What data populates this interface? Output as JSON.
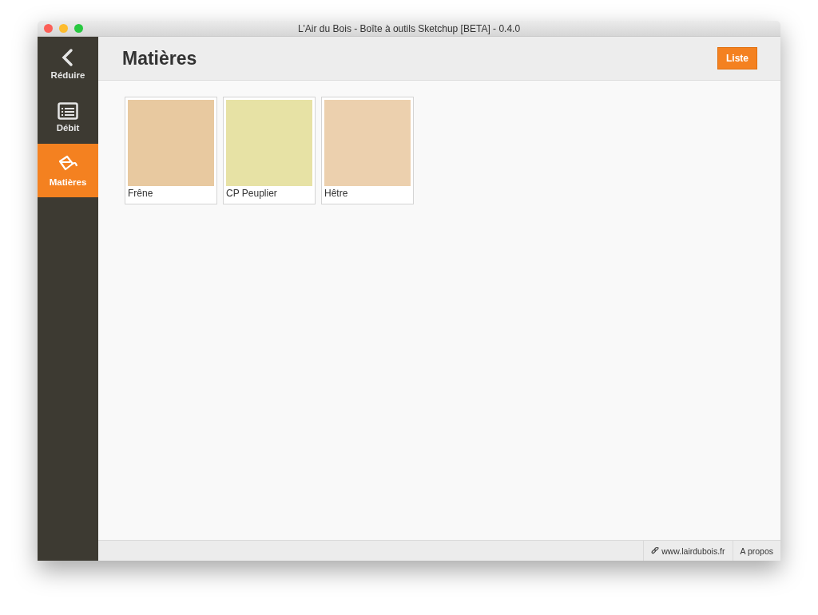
{
  "window": {
    "title": "L'Air du Bois - Boîte à outils Sketchup [BETA] - 0.4.0"
  },
  "sidebar": {
    "items": [
      {
        "kind": "back",
        "label": "Réduire",
        "selected": false
      },
      {
        "kind": "list",
        "label": "Débit",
        "selected": false
      },
      {
        "kind": "paint",
        "label": "Matières",
        "selected": true
      }
    ]
  },
  "header": {
    "title": "Matières",
    "button": "Liste"
  },
  "materials": [
    {
      "name": "Frêne",
      "color": "#e8c9a0"
    },
    {
      "name": "CP Peuplier",
      "color": "#e7e2a5"
    },
    {
      "name": "Hêtre",
      "color": "#ecd0ae"
    }
  ],
  "status_bar": {
    "link": "www.lairdubois.fr",
    "about": "A propos"
  }
}
